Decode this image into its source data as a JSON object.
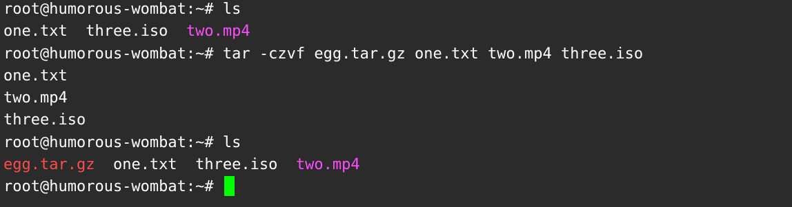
{
  "terminal": {
    "colors": {
      "background": "#2b2b2b",
      "text": "#ffffff",
      "archive": "#ff4d4d",
      "media": "#ff4dff",
      "cursor": "#00ff00"
    },
    "lines": [
      {
        "prompt": "root@humorous-wombat:~# ",
        "command": "ls"
      },
      {
        "files": [
          "one.txt",
          "three.iso",
          "two.mp4"
        ]
      },
      {
        "prompt": "root@humorous-wombat:~# ",
        "command": "tar -czvf egg.tar.gz one.txt two.mp4 three.iso"
      },
      {
        "text": "one.txt"
      },
      {
        "text": "two.mp4"
      },
      {
        "text": "three.iso"
      },
      {
        "prompt": "root@humorous-wombat:~# ",
        "command": "ls"
      },
      {
        "files": [
          "egg.tar.gz",
          "one.txt",
          "three.iso",
          "two.mp4"
        ]
      },
      {
        "prompt": "root@humorous-wombat:~# ",
        "command": ""
      }
    ]
  }
}
